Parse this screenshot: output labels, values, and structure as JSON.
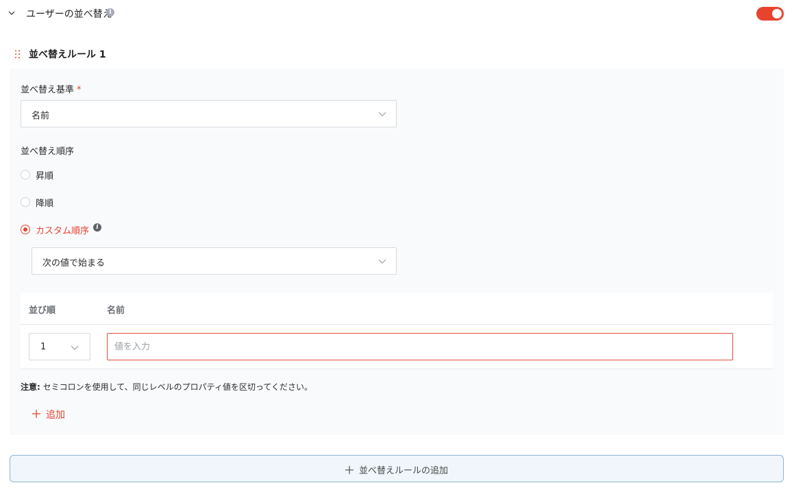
{
  "section": {
    "title": "ユーザーの並べ替え",
    "toggle_on": true
  },
  "rule": {
    "title": "並べ替えルール 1",
    "criterion_label": "並べ替え基準",
    "required_mark": "*",
    "criterion_value": "名前",
    "order_label": "並べ替え順序",
    "options": [
      "昇順",
      "降順",
      "カスタム順序"
    ],
    "selected_option": "カスタム順序",
    "custom_mode_value": "次の値で始まる",
    "table": {
      "headers": [
        "並び順",
        "名前"
      ],
      "rows": [
        {
          "order": "1",
          "value": "",
          "placeholder": "値を入力"
        }
      ]
    },
    "note_label": "注意:",
    "note_text": "セミコロンを使用して、同じレベルのプロパティ値を区切ってください。",
    "add_label": "追加"
  },
  "add_rule_label": "並べ替えルールの追加",
  "colors": {
    "accent": "#e8432e",
    "card_bg": "#f9fafc",
    "button_border": "#8fb3d1"
  }
}
